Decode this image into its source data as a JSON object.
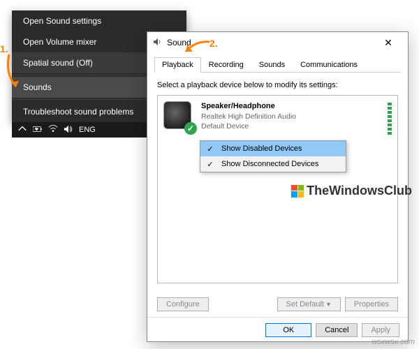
{
  "annotations": {
    "step1": "1.",
    "step2": "2."
  },
  "context_menu": {
    "items": [
      {
        "label": "Open Sound settings"
      },
      {
        "label": "Open Volume mixer"
      },
      {
        "label": "Spatial sound (Off)"
      },
      {
        "label": "Sounds"
      },
      {
        "label": "Troubleshoot sound problems"
      }
    ]
  },
  "taskbar": {
    "lang": "ENG"
  },
  "dialog": {
    "title": "Sound",
    "tabs": [
      "Playback",
      "Recording",
      "Sounds",
      "Communications"
    ],
    "instruction": "Select a playback device below to modify its settings:",
    "device": {
      "name": "Speaker/Headphone",
      "driver": "Realtek High Definition Audio",
      "status": "Default Device"
    },
    "rcmenu": {
      "item1": "Show Disabled Devices",
      "item2": "Show Disconnected Devices"
    },
    "buttons": {
      "configure": "Configure",
      "set_default": "Set Default",
      "properties": "Properties",
      "ok": "OK",
      "cancel": "Cancel",
      "apply": "Apply"
    }
  },
  "watermark": "TheWindowsClub",
  "sitemark": "wsxwsx.com"
}
